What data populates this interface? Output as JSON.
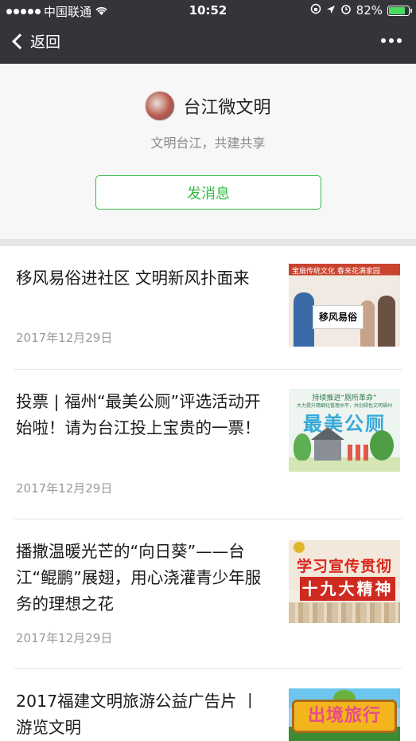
{
  "status_bar": {
    "carrier": "中国联通",
    "time": "10:52",
    "battery_text": "82%",
    "battery_level": 0.82
  },
  "nav": {
    "back_label": "返回",
    "back_icon": "chevron-left",
    "more_icon": "ellipsis"
  },
  "profile": {
    "name": "台江微文明",
    "subtitle": "文明台江，共建共享",
    "send_label": "发消息"
  },
  "articles": [
    {
      "title": "移风易俗进社区 文明新风扑面来",
      "date": "2017年12月29日",
      "thumb": {
        "header": "宝扇传统文化 春来花满家园",
        "paper": "移风易俗"
      }
    },
    {
      "title": "投票 | 福州“最美公厕”评选活动开始啦！请为台江投上宝贵的一票！",
      "date": "2017年12月29日",
      "thumb": {
        "header": "持续推进“厕所革命”",
        "subheader": "大力提升精细化管理水平，共创绿色文明福州",
        "big": "最美公厕"
      }
    },
    {
      "title": "播撒温暖光芒的“向日葵”——台江“鲲鹏”展翅，用心浇灌青少年服务的理想之花",
      "date": "2017年12月29日",
      "thumb": {
        "line1": "学习宣传贯彻",
        "line2": "十九大精神"
      }
    },
    {
      "title": "2017福建文明旅游公益广告片 丨游览文明",
      "date": "",
      "thumb": {
        "sign": "出境旅行"
      }
    }
  ],
  "colors": {
    "nav_bg": "#333539",
    "accent_green": "#33b946",
    "battery_green": "#4cd964"
  }
}
